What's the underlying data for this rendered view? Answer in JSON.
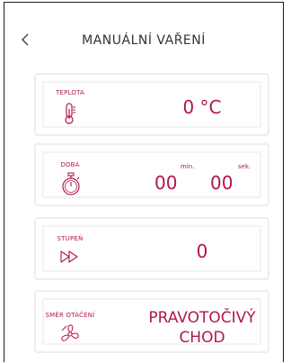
{
  "header": {
    "back_glyph": "<",
    "title": "MANUÁLNÍ VAŘENÍ"
  },
  "cards": {
    "temperature": {
      "label": "TEPLOTA",
      "value": "0 °C",
      "icon": "thermometer-icon"
    },
    "duration": {
      "label": "DOBA",
      "minutes": "00",
      "seconds": "00",
      "min_unit": "min.",
      "sec_unit": "sek.",
      "icon": "stopwatch-icon"
    },
    "level": {
      "label": "STUPEŇ",
      "value": "0",
      "icon": "fast-forward-icon"
    },
    "direction": {
      "label": "SMĚR OTÁČENÍ",
      "value_line1": "PRAVOTOČIVÝ",
      "value_line2": "CHOD",
      "icon": "fan-icon"
    }
  },
  "colors": {
    "accent": "#b01845",
    "border": "#eeeeee",
    "text": "#333333"
  }
}
